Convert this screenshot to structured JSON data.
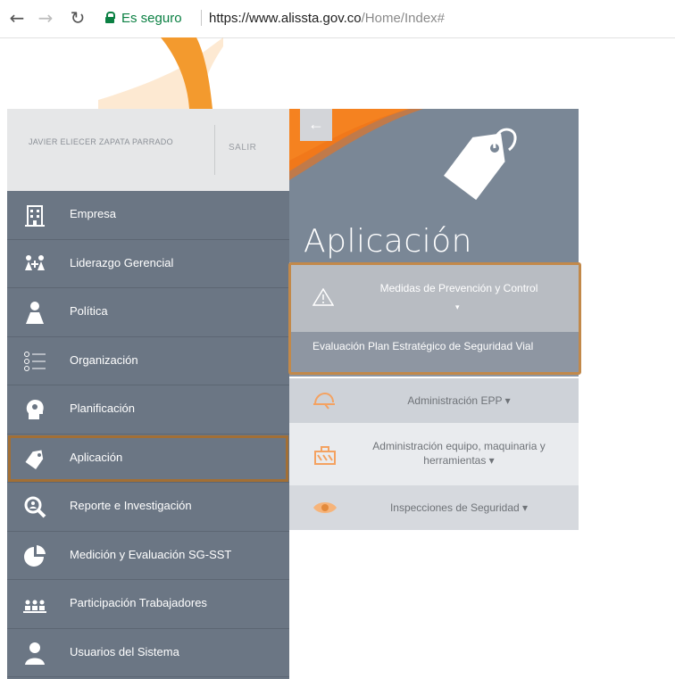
{
  "browser": {
    "secure_label": "Es seguro",
    "url_main": "https://www.alissta.gov.co",
    "url_path": "/Home/Index#"
  },
  "sidebar": {
    "user_name": "JAVIER ELIECER ZAPATA PARRADO",
    "logout": "SALIR",
    "items": [
      {
        "label": "Empresa",
        "icon": "building-icon"
      },
      {
        "label": "Liderazgo Gerencial",
        "icon": "leadership-icon"
      },
      {
        "label": "Política",
        "icon": "user-document-icon"
      },
      {
        "label": "Organización",
        "icon": "list-icon"
      },
      {
        "label": "Planificación",
        "icon": "head-gear-icon"
      },
      {
        "label": "Aplicación",
        "icon": "tag-icon"
      },
      {
        "label": "Reporte e Investigación",
        "icon": "magnifier-icon"
      },
      {
        "label": "Medición y Evaluación SG-SST",
        "icon": "pie-chart-icon"
      },
      {
        "label": "Participación Trabajadores",
        "icon": "people-icon"
      },
      {
        "label": "Usuarios del Sistema",
        "icon": "user-icon"
      }
    ]
  },
  "panel": {
    "title": "Aplicación",
    "submenu": [
      {
        "label": "Medidas de Prevención y Control",
        "caret": "▾",
        "icon": "warning-icon"
      },
      {
        "label": "Evaluación Plan Estratégico de Seguridad Vial"
      },
      {
        "label": "Administración EPP ▾",
        "icon": "hardhat-icon"
      },
      {
        "label": "Administración equipo, maquinaria y herramientas ▾",
        "icon": "toolbox-icon"
      },
      {
        "label": "Inspecciones de Seguridad ▾",
        "icon": "eye-icon"
      }
    ]
  },
  "colors": {
    "sidebar_bg": "#6b7684",
    "accent": "#f58220",
    "highlight_border": "#c2894a"
  }
}
